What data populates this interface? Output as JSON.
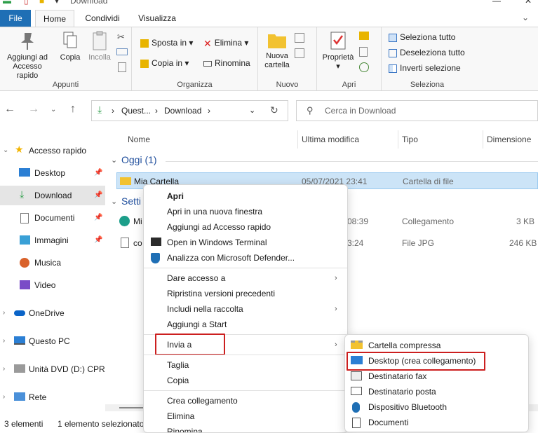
{
  "window": {
    "title": "Download"
  },
  "ribbon_tabs": {
    "file": "File",
    "home": "Home",
    "share": "Condividi",
    "view": "Visualizza"
  },
  "ribbon": {
    "appunti": {
      "label": "Appunti",
      "pin_line1": "Aggiungi ad",
      "pin_line2": "Accesso rapido",
      "copy": "Copia",
      "paste": "Incolla"
    },
    "organizza": {
      "label": "Organizza",
      "move_to": "Sposta in",
      "delete": "Elimina",
      "copy_to": "Copia in",
      "rename": "Rinomina"
    },
    "nuovo": {
      "label": "Nuovo",
      "new_folder_line1": "Nuova",
      "new_folder_line2": "cartella"
    },
    "apri": {
      "label": "Apri",
      "properties": "Proprietà"
    },
    "seleziona": {
      "label": "Seleziona",
      "select_all": "Seleziona tutto",
      "deselect_all": "Deseleziona tutto",
      "invert": "Inverti selezione"
    }
  },
  "address": {
    "seg1": "Quest...",
    "seg2": "Download",
    "search_placeholder": "Cerca in Download"
  },
  "nav": {
    "quick_access": "Accesso rapido",
    "desktop": "Desktop",
    "download": "Download",
    "documents": "Documenti",
    "images": "Immagini",
    "music": "Musica",
    "video": "Video",
    "onedrive": "OneDrive",
    "this_pc": "Questo PC",
    "dvd": "Unità DVD (D:) CPRA",
    "network": "Rete"
  },
  "columns": {
    "name": "Nome",
    "modified": "Ultima modifica",
    "type": "Tipo",
    "size": "Dimensione"
  },
  "groups": {
    "today": "Oggi (1)",
    "week": "Setti"
  },
  "files": {
    "folder": {
      "name": "Mia Cartella",
      "modified": "05/07/2021 23:41",
      "type": "Cartella di file"
    },
    "shortcut": {
      "name": "Mi",
      "modified": "08:39",
      "type": "Collegamento",
      "size": "3 KB"
    },
    "jpg": {
      "name": "co",
      "modified": "3:24",
      "type": "File JPG",
      "size": "246 KB"
    }
  },
  "status": {
    "count": "3 elementi",
    "selected": "1 elemento selezionato"
  },
  "context_menu": {
    "open": "Apri",
    "open_new_window": "Apri in una nuova finestra",
    "pin_quick": "Aggiungi ad Accesso rapido",
    "open_terminal": "Open in Windows Terminal",
    "defender": "Analizza con Microsoft Defender...",
    "give_access": "Dare accesso a",
    "restore_versions": "Ripristina versioni precedenti",
    "include_library": "Includi nella raccolta",
    "pin_start": "Aggiungi a Start",
    "send_to": "Invia a",
    "cut": "Taglia",
    "copy": "Copia",
    "create_shortcut": "Crea collegamento",
    "delete": "Elimina",
    "rename": "Rinomina"
  },
  "send_to_menu": {
    "zip": "Cartella compressa",
    "desktop": "Desktop (crea collegamento)",
    "fax": "Destinatario fax",
    "mail": "Destinatario posta",
    "bluetooth": "Dispositivo Bluetooth",
    "documents": "Documenti"
  },
  "colors": {
    "accent": "#1f6fb5",
    "highlight_box": "#cc1f1f",
    "selection": "#cce4f7"
  }
}
